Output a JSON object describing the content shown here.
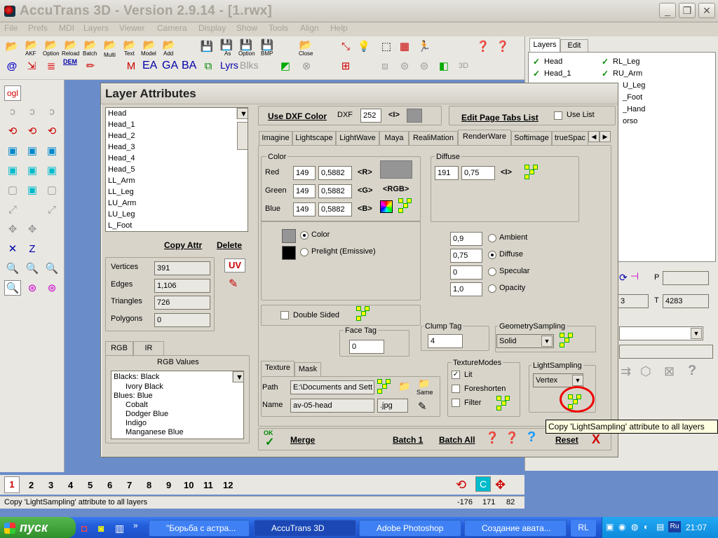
{
  "app": {
    "title": "AccuTrans 3D - Version 2.9.14 - [1.rwx]",
    "menu": [
      "File",
      "Prefs",
      "MDI",
      "Layers",
      "Viewer",
      "Camera",
      "Display",
      "Show",
      "Tools",
      "Align",
      "Help"
    ],
    "toolbar_labels": [
      "AKF",
      "Option",
      "Reload",
      "Batch",
      "Multi",
      "Text",
      "Model",
      "Add",
      "As",
      "Option",
      "BMP",
      "Close"
    ],
    "toolbar_row2": [
      "@",
      "DEM",
      "EA",
      "GA",
      "BA",
      "Lyrs",
      "Blks"
    ],
    "left_panel": {
      "ogl": "ogl"
    },
    "layers_panel": {
      "tabs": [
        "Layers",
        "Edit"
      ],
      "col1": [
        "Head",
        "Head_1"
      ],
      "col2": [
        "RL_Leg",
        "RU_Arm",
        "U_Leg",
        "_Foot",
        "_Hand",
        "orso"
      ],
      "p_label": "P",
      "t_label": "T",
      "t_value": "4283",
      "field3": "3"
    },
    "statusbar_text": "Copy 'LightSampling' attribute to all layers",
    "status_numbers": [
      "1",
      "2",
      "3",
      "4",
      "5",
      "6",
      "7",
      "8",
      "9",
      "10",
      "11",
      "12"
    ],
    "status_coords": [
      "-176",
      "171",
      "82"
    ]
  },
  "dialog": {
    "title": "Layer Attributes",
    "layers": [
      "Head",
      "Head_1",
      "Head_2",
      "Head_3",
      "Head_4",
      "Head_5",
      "LL_Arm",
      "LL_Leg",
      "LU_Arm",
      "LU_Leg",
      "L_Foot"
    ],
    "copy_attr": "Copy Attr",
    "delete": "Delete",
    "uv": "UV",
    "stats": [
      {
        "label": "Vertices",
        "value": "391"
      },
      {
        "label": "Edges",
        "value": "1,106"
      },
      {
        "label": "Triangles",
        "value": "726"
      },
      {
        "label": "Polygons",
        "value": "0"
      }
    ],
    "color_tabs": [
      "RGB",
      "IR"
    ],
    "rgb_values_title": "RGB Values",
    "rgb_list": [
      "Blacks: Black",
      "Ivory Black",
      "Blues: Blue",
      "Cobalt",
      "Dodger Blue",
      "Indigo",
      "Manganese Blue"
    ],
    "use_dxf_color": "Use DXF Color",
    "dxf_label": "DXF",
    "dxf_value": "252",
    "dxf_btn": "<I>",
    "edit_page_tabs": "Edit Page Tabs List",
    "use_list": "Use List",
    "format_tabs": [
      "Imagine",
      "Lightscape",
      "LightWave",
      "Maya",
      "RealiMation",
      "RenderWare",
      "Softimage",
      "trueSpac"
    ],
    "color_group": {
      "title": "Color",
      "rows": [
        {
          "label": "Red",
          "v1": "149",
          "v2": "0,5882",
          "btn": "<R>"
        },
        {
          "label": "Green",
          "v1": "149",
          "v2": "0,5882",
          "btn": "<G>"
        },
        {
          "label": "Blue",
          "v1": "149",
          "v2": "0,5882",
          "btn": "<B>"
        }
      ],
      "rgb_btn": "<RGB>",
      "swatch_color": "#959595",
      "radio_color": "Color",
      "radio_prelight": "Prelight (Emissive)"
    },
    "double_sided": "Double Sided",
    "diffuse_group": {
      "title": "Diffuse",
      "v1": "191",
      "v2": "0,75",
      "btn": "<I>"
    },
    "lighting": [
      {
        "value": "0,9",
        "label": "Ambient"
      },
      {
        "value": "0,75",
        "label": "Diffuse"
      },
      {
        "value": "0",
        "label": "Specular"
      },
      {
        "value": "1,0",
        "label": "Opacity"
      }
    ],
    "face_tag": {
      "title": "Face Tag",
      "value": "0"
    },
    "clump_tag": {
      "title": "Clump Tag",
      "value": "4"
    },
    "geometry_sampling": {
      "title": "GeometrySampling",
      "value": "Solid"
    },
    "texture_tabs": [
      "Texture",
      "Mask"
    ],
    "path_label": "Path",
    "path_value": "E:\\Documents and Sett",
    "name_label": "Name",
    "name_value": "av-05-head",
    "ext_value": ".jpg",
    "same_label": "Same",
    "texture_modes": {
      "title": "TextureModes",
      "items": [
        {
          "label": "Lit",
          "checked": "✓"
        },
        {
          "label": "Foreshorten",
          "checked": ""
        },
        {
          "label": "Filter",
          "checked": ""
        }
      ]
    },
    "light_sampling": {
      "title": "LightSampling",
      "value": "Vertex"
    },
    "ok": "OK",
    "merge": "Merge",
    "batch1": "Batch 1",
    "batch_all": "Batch All",
    "reset": "Reset",
    "close_x": "X"
  },
  "tooltip": "Copy 'LightSampling' attribute to all layers",
  "taskbar": {
    "start": "пуск",
    "tasks": [
      "\"Борьба с астра...",
      "AccuTrans 3D",
      "Adobe Photoshop",
      "Создание авата..."
    ],
    "lang_btn": "RL",
    "lang": "Ru",
    "time": "21:07"
  }
}
